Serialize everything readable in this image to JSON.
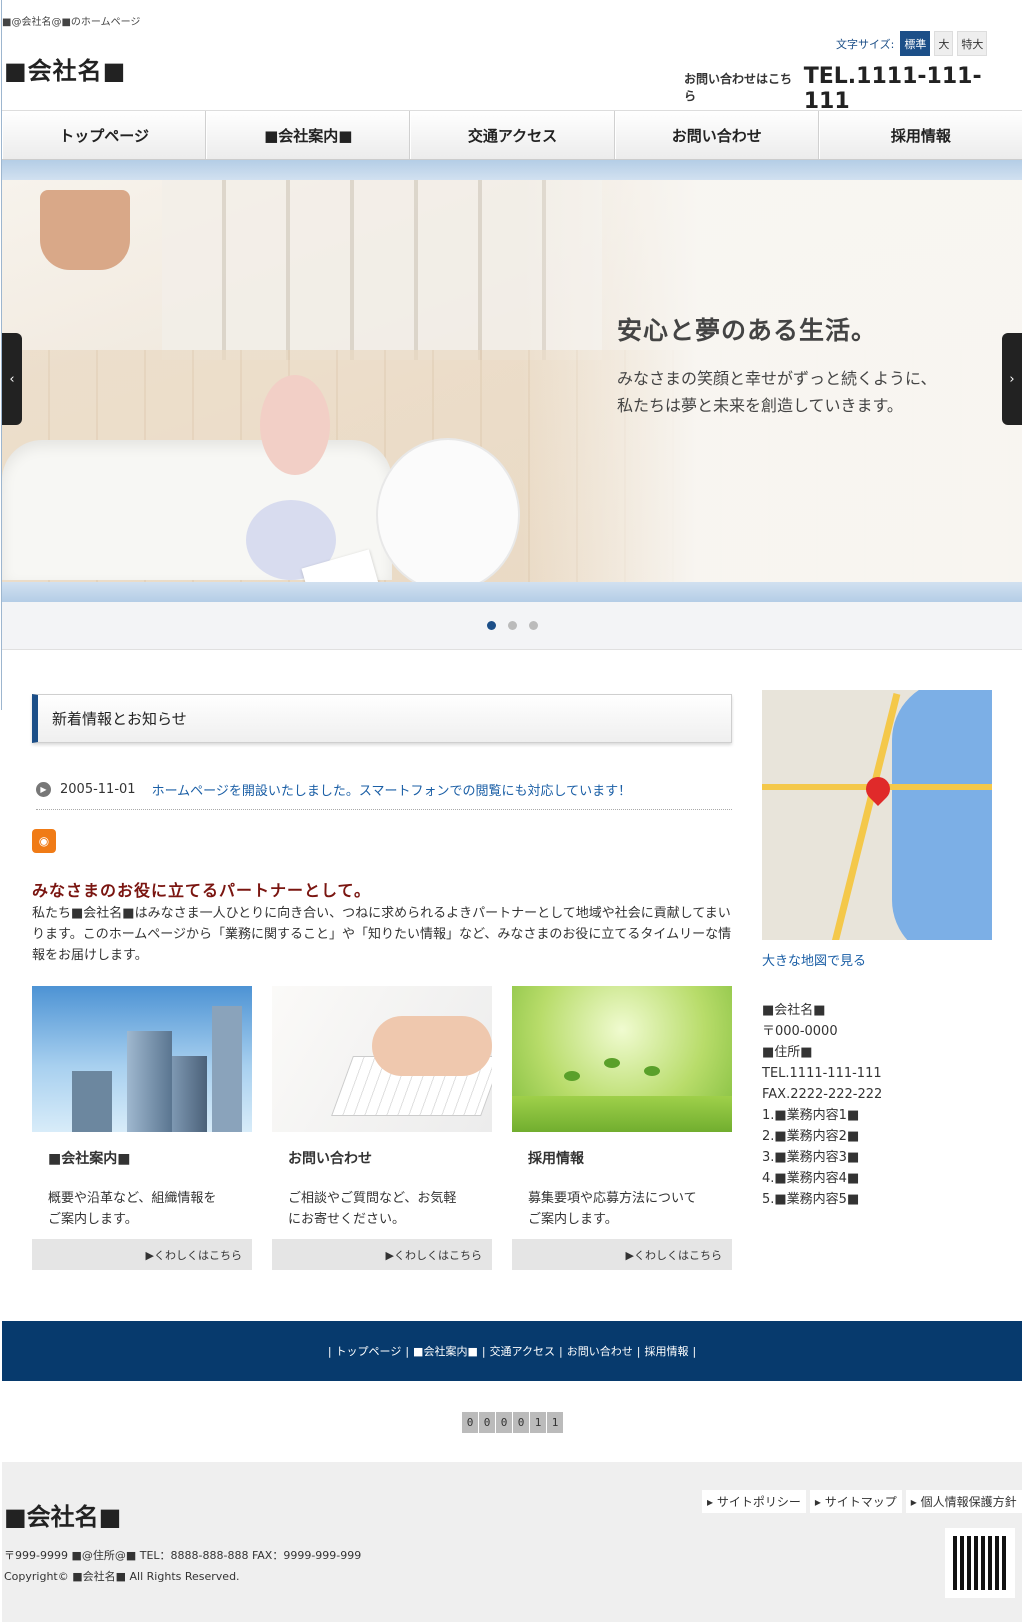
{
  "header": {
    "tagline": "■@会社名@■のホームページ",
    "site_title": "■会社名■",
    "fontsize_label": "文字サイズ:",
    "fontsize_options": [
      "標準",
      "大",
      "特大"
    ],
    "contact_label": "お問い合わせはこちら",
    "tel": "TEL.1111-111-111"
  },
  "nav": [
    "トップページ",
    "■会社案内■",
    "交通アクセス",
    "お問い合わせ",
    "採用情報"
  ],
  "hero": {
    "title": "安心と夢のある生活。",
    "lead_line1": "みなさまの笑顔と幸せがずっと続くように、",
    "lead_line2": "私たちは夢と未来を創造していきます。",
    "prev": "‹",
    "next": "›",
    "slide_count": 3,
    "active_slide": 1
  },
  "news": {
    "heading": "新着情報とお知らせ",
    "items": [
      {
        "date": "2005-11-01",
        "text": "ホームページを開設いたしました。スマートフォンでの閲覧にも対応しています！"
      }
    ]
  },
  "intro": {
    "title": "みなさまのお役に立てるパートナーとして。",
    "body": "私たち■会社名■はみなさま一人ひとりに向き合い、つねに求められるよきパートナーとして地域や社会に貢献してまいります。このホームページから「業務に関すること」や「知りたい情報」など、みなさまのお役に立てるタイムリーな情報をお届けします。"
  },
  "cards": [
    {
      "title": "■会社案内■",
      "line1": "概要や沿革など、組織情報を",
      "line2": "ご案内します。",
      "more": "▶くわしくはこちら"
    },
    {
      "title": "お問い合わせ",
      "line1": "ご相談やご質問など、お気軽",
      "line2": "にお寄せください。",
      "more": "▶くわしくはこちら"
    },
    {
      "title": "採用情報",
      "line1": "募集要項や応募方法について",
      "line2": "ご案内します。",
      "more": "▶くわしくはこちら"
    }
  ],
  "sidebar": {
    "map_link": "大きな地図で見る",
    "company": [
      "■会社名■",
      "〒000-0000",
      "■住所■",
      "TEL.1111-111-111",
      "FAX.2222-222-222",
      "1.■業務内容1■",
      "2.■業務内容2■",
      "3.■業務内容3■",
      "4.■業務内容4■",
      "5.■業務内容5■"
    ]
  },
  "footer_nav": [
    "トップページ",
    "■会社案内■",
    "交通アクセス",
    "お問い合わせ",
    "採用情報"
  ],
  "counter": [
    "0",
    "0",
    "0",
    "0",
    "1",
    "1"
  ],
  "footer": {
    "title": "■会社名■",
    "address": "〒999-9999 ■@住所@■ TEL：8888-888-888 FAX：9999-999-999",
    "copyright": "Copyright© ■会社名■ All Rights Reserved.",
    "links": [
      "サイトポリシー",
      "サイトマップ",
      "個人情報保護方針"
    ]
  },
  "colors": {
    "accent": "#1c4f88",
    "footer_nav_bg": "#073a6d",
    "intro_title": "#7a1510",
    "link": "#1b5fa6"
  }
}
